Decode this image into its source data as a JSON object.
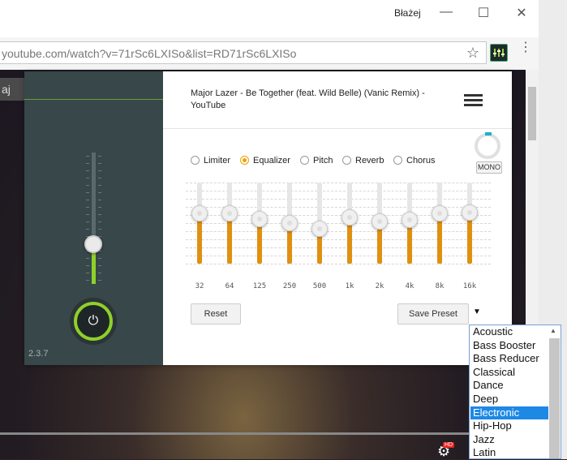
{
  "window": {
    "user_name": "Błażej",
    "minimize_glyph": "—",
    "maximize_glyph": "☐",
    "close_glyph": "✕"
  },
  "browser": {
    "url": "youtube.com/watch?v=71rSc6LXISo&list=RD71rSc6LXISo",
    "star_glyph": "☆",
    "menu_glyph": "⋮",
    "extension_icon": "equalizer-extension-icon"
  },
  "video": {
    "tab_text": "aj",
    "gear_glyph": "⚙",
    "hd_badge": "HD"
  },
  "popup": {
    "track_title": "Major Lazer - Be Together (feat. Wild Belle) (Vanic Remix) - YouTube",
    "version": "2.3.7",
    "power_glyph": "⏻",
    "mono_label": "MONO",
    "volume_level": 0.3,
    "tabs": [
      {
        "label": "Limiter",
        "selected": false
      },
      {
        "label": "Equalizer",
        "selected": true
      },
      {
        "label": "Pitch",
        "selected": false
      },
      {
        "label": "Reverb",
        "selected": false
      },
      {
        "label": "Chorus",
        "selected": false
      }
    ],
    "eq_bands": [
      {
        "label": "32",
        "level": 0.62
      },
      {
        "label": "64",
        "level": 0.62
      },
      {
        "label": "125",
        "level": 0.55
      },
      {
        "label": "250",
        "level": 0.5
      },
      {
        "label": "500",
        "level": 0.43
      },
      {
        "label": "1k",
        "level": 0.57
      },
      {
        "label": "2k",
        "level": 0.52
      },
      {
        "label": "4k",
        "level": 0.54
      },
      {
        "label": "8k",
        "level": 0.62
      },
      {
        "label": "16k",
        "level": 0.63
      }
    ],
    "reset_label": "Reset",
    "save_preset_label": "Save Preset",
    "preset_arrow": "▼"
  },
  "presets": {
    "items": [
      "Acoustic",
      "Bass Booster",
      "Bass Reducer",
      "Classical",
      "Dance",
      "Deep",
      "Electronic",
      "Hip-Hop",
      "Jazz",
      "Latin"
    ],
    "selected": "Electronic",
    "scroll_up_glyph": "▲"
  },
  "colors": {
    "accent": "#8fd02a",
    "eq_fill": "#e09010",
    "radio_selected": "#f0a000",
    "selection": "#1e88e5"
  }
}
